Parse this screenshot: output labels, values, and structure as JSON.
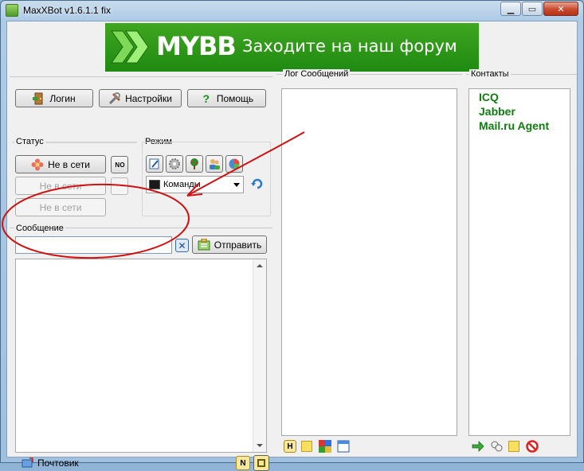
{
  "window": {
    "title": "MaxXBot v1.6.1.1 fix"
  },
  "banner": {
    "logo": "MYBB",
    "slogan": "Заходите на наш форум"
  },
  "toolbar": {
    "login": "Логин",
    "settings": "Настройки",
    "help": "Помощь"
  },
  "status": {
    "label": "Статус",
    "primary": "Не в сети",
    "secondary": "Не в сети",
    "tertiary": "Не в сети",
    "indicator": "N O"
  },
  "mode": {
    "label": "Режим",
    "command_select": "Команды"
  },
  "message": {
    "label": "Сообщение",
    "input_value": "",
    "send": "Отправить"
  },
  "log": {
    "label": "Лог Сообщений"
  },
  "contacts": {
    "label": "Контакты",
    "items": [
      "ICQ",
      "Jabber",
      "Mail.ru Agent"
    ]
  },
  "mailer": {
    "label": "Почтовик"
  },
  "log_toolbar": {
    "h_label": "H"
  },
  "message_toolbar": {
    "n_label": "N"
  },
  "colors": {
    "banner": "#2a961a",
    "contact_text": "#117a11",
    "annotation": "#d11010"
  }
}
